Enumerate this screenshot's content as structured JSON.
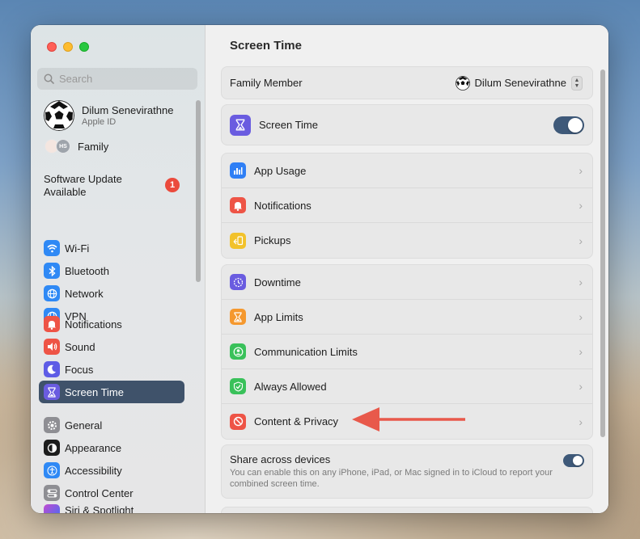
{
  "sidebar": {
    "search_placeholder": "Search",
    "profile": {
      "name": "Dilum Senevirathne",
      "subtitle": "Apple ID"
    },
    "family": {
      "initials": "HS",
      "label": "Family"
    },
    "software_update": {
      "label": "Software Update Available",
      "badge": "1"
    },
    "group1": [
      {
        "label": "Wi-Fi",
        "icon": "wifi-icon",
        "color": "#2f89f5"
      },
      {
        "label": "Bluetooth",
        "icon": "bluetooth-icon",
        "color": "#2f89f5"
      },
      {
        "label": "Network",
        "icon": "globe-icon",
        "color": "#2f89f5"
      },
      {
        "label": "VPN",
        "icon": "globe-icon",
        "color": "#2f89f5"
      }
    ],
    "group2": [
      {
        "label": "Notifications",
        "icon": "bell-icon",
        "color": "#ee5446"
      },
      {
        "label": "Sound",
        "icon": "speaker-icon",
        "color": "#ee5446"
      },
      {
        "label": "Focus",
        "icon": "moon-icon",
        "color": "#5e5ce6"
      },
      {
        "label": "Screen Time",
        "icon": "hourglass-icon",
        "color": "#6a5ce0",
        "selected": true
      }
    ],
    "group3": [
      {
        "label": "General",
        "icon": "gear-icon",
        "color": "#8e8e93"
      },
      {
        "label": "Appearance",
        "icon": "appearance-icon",
        "color": "#1d1d1d"
      },
      {
        "label": "Accessibility",
        "icon": "accessibility-icon",
        "color": "#2f89f5"
      },
      {
        "label": "Control Center",
        "icon": "control-center-icon",
        "color": "#8e8e93"
      },
      {
        "label": "Siri & Spotlight",
        "icon": "siri-icon",
        "color": "#c44bd0"
      }
    ]
  },
  "main": {
    "title": "Screen Time",
    "family_member": {
      "label": "Family Member",
      "value": "Dilum Senevirathne"
    },
    "screen_time_row": {
      "label": "Screen Time",
      "enabled": true
    },
    "usage_rows": [
      {
        "label": "App Usage",
        "icon": "bar-chart-icon",
        "color": "#2f7ff5"
      },
      {
        "label": "Notifications",
        "icon": "bell-icon",
        "color": "#ee5446"
      },
      {
        "label": "Pickups",
        "icon": "pickup-icon",
        "color": "#f2c22b"
      }
    ],
    "limit_rows": [
      {
        "label": "Downtime",
        "icon": "downtime-icon",
        "color": "#6a5ce0"
      },
      {
        "label": "App Limits",
        "icon": "hourglass-icon",
        "color": "#f5982e"
      },
      {
        "label": "Communication Limits",
        "icon": "person-circle-icon",
        "color": "#39c15a"
      },
      {
        "label": "Always Allowed",
        "icon": "checkmark-icon",
        "color": "#39c15a"
      },
      {
        "label": "Content & Privacy",
        "icon": "no-entry-icon",
        "color": "#ee5446"
      }
    ],
    "share": {
      "label": "Share across devices",
      "description": "You can enable this on any iPhone, iPad, or Mac signed in to iCloud to report your combined screen time.",
      "enabled": true
    }
  },
  "colors": {
    "accent": "#3e5979",
    "arrow": "#e8594b",
    "selected": "#3f526a"
  }
}
